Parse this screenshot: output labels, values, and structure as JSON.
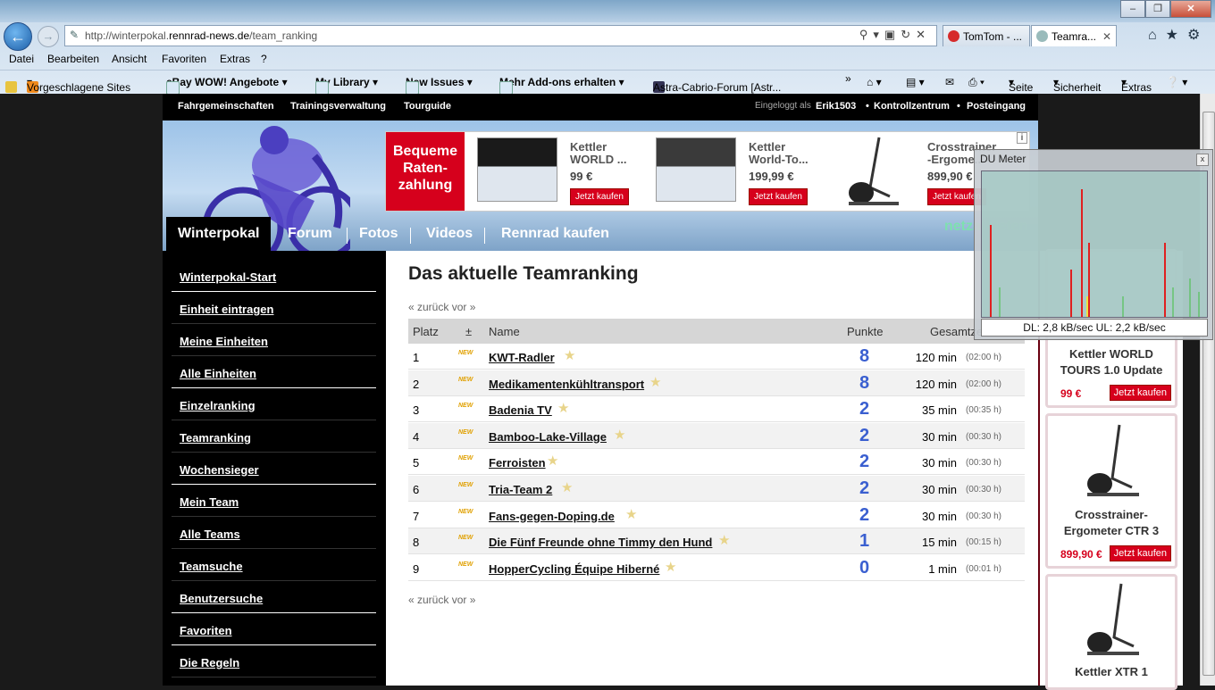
{
  "browser": {
    "url_prefix": "http://winterpokal.",
    "url_domain": "rennrad-news.de",
    "url_path": "/team_ranking",
    "tabs": [
      {
        "label": "TomTom - ...",
        "active": false
      },
      {
        "label": "Teamra...",
        "active": true
      }
    ],
    "menu": [
      "Datei",
      "Bearbeiten",
      "Ansicht",
      "Favoriten",
      "Extras",
      "?"
    ],
    "favorites": [
      "Vorgeschlagene Sites",
      "eBay WOW! Angebote",
      "My Library",
      "New Issues",
      "Mehr Add-ons erhalten",
      "Astra-Cabrio-Forum  [Astr..."
    ],
    "commandbar": [
      "Seite",
      "Sicherheit",
      "Extras"
    ]
  },
  "topnav": {
    "links": [
      "Fahrgemeinschaften",
      "Trainingsverwaltung",
      "Tourguide"
    ],
    "logged_in_label": "Eingeloggt als",
    "user": "Erik1503",
    "control": "Kontrollzentrum",
    "inbox": "Posteingang"
  },
  "banner_ad": {
    "promo": "Bequeme Raten-zahlung",
    "products": [
      {
        "name": "Kettler WORLD ...",
        "price": "99 €",
        "button": "Jetzt kaufen"
      },
      {
        "name": "Kettler World-To...",
        "price": "199,99 €",
        "button": "Jetzt kaufen"
      },
      {
        "name": "Crosstrainer -Ergome...",
        "price": "899,90 €",
        "button": "Jetzt kaufen"
      }
    ],
    "info": "i"
  },
  "mainnav": {
    "items": [
      "Winterpokal",
      "Forum",
      "Fotos",
      "Videos",
      "Rennrad kaufen"
    ],
    "partner": "netzathleten"
  },
  "sidebar": {
    "items": [
      "Winterpokal-Start",
      "Einheit eintragen",
      "Meine Einheiten",
      "Alle Einheiten",
      "Einzelranking",
      "Teamranking",
      "Wochensieger",
      "Mein Team",
      "Alle Teams",
      "Teamsuche",
      "Benutzersuche",
      "Favoriten",
      "Die Regeln"
    ]
  },
  "content": {
    "title": "Das aktuelle Teamranking",
    "pager_back": "« zurück",
    "pager_fwd": "vor »",
    "headers": {
      "place": "Platz",
      "pm": "±",
      "name": "Name",
      "points": "Punkte",
      "total": "Gesamtzeit"
    },
    "new_badge": "NEW",
    "rows": [
      {
        "place": "1",
        "name": "KWT-Radler",
        "points": "8",
        "min": "120 min",
        "hours": "(02:00 h)"
      },
      {
        "place": "2",
        "name": "Medikamentenkühltransport",
        "points": "8",
        "min": "120 min",
        "hours": "(02:00 h)"
      },
      {
        "place": "3",
        "name": "Badenia TV",
        "points": "2",
        "min": "35 min",
        "hours": "(00:35 h)"
      },
      {
        "place": "4",
        "name": "Bamboo-Lake-Village",
        "points": "2",
        "min": "30 min",
        "hours": "(00:30 h)"
      },
      {
        "place": "5",
        "name": "Ferroisten",
        "points": "2",
        "min": "30 min",
        "hours": "(00:30 h)"
      },
      {
        "place": "6",
        "name": "Tria-Team 2",
        "points": "2",
        "min": "30 min",
        "hours": "(00:30 h)"
      },
      {
        "place": "7",
        "name": "Fans-gegen-Doping.de",
        "points": "2",
        "min": "30 min",
        "hours": "(00:30 h)"
      },
      {
        "place": "8",
        "name": "Die Fünf Freunde ohne Timmy den Hund",
        "points": "1",
        "min": "15 min",
        "hours": "(00:15 h)"
      },
      {
        "place": "9",
        "name": "HopperCycling Équipe Hiberné",
        "points": "0",
        "min": "1 min",
        "hours": "(00:01 h)"
      }
    ]
  },
  "right_ads": [
    {
      "title": "Kettler WORLD TOURS 1.0 Update",
      "price": "99 €",
      "button": "Jetzt kaufen"
    },
    {
      "title": "Crosstrainer-Ergometer CTR 3",
      "price": "899,90 €",
      "button": "Jetzt kaufen"
    },
    {
      "title": "Kettler XTR 1",
      "price": "",
      "button": ""
    }
  ],
  "du_meter": {
    "title": "DU Meter",
    "close": "x",
    "status": "DL: 2,8 kB/sec  UL: 2,2 kB/sec"
  }
}
